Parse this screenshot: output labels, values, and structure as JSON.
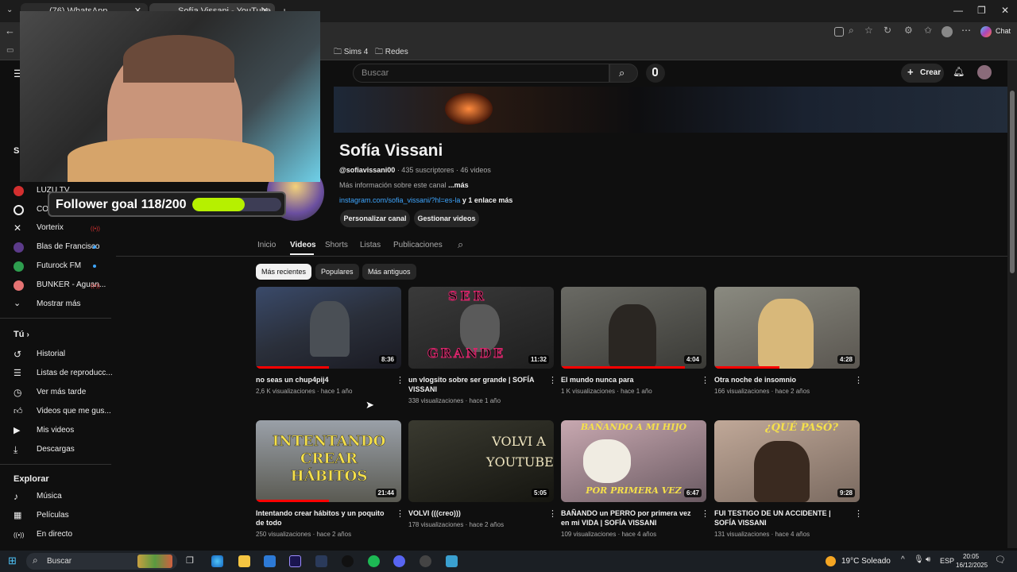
{
  "browser": {
    "tabs": [
      {
        "label": "(76) WhatsApp"
      },
      {
        "label": "Sofía Vissani - YouTube"
      }
    ],
    "bookmarks": [
      "Sims 4",
      "Redes"
    ],
    "chat_label": "Chat"
  },
  "youtube": {
    "search_placeholder": "Buscar",
    "create_label": "Crear",
    "sidebar": {
      "subscriptions": [
        {
          "label": "LUZU TV"
        },
        {
          "label": "COM"
        },
        {
          "label": "Vorterix"
        },
        {
          "label": "Blas de Francisco"
        },
        {
          "label": "Futurock FM"
        },
        {
          "label": "BUNKER - Aguan..."
        }
      ],
      "show_more": "Mostrar más",
      "you_header": "Tú",
      "you_items": [
        {
          "label": "Historial"
        },
        {
          "label": "Listas de reproducc..."
        },
        {
          "label": "Ver más tarde"
        },
        {
          "label": "Videos que me gus..."
        },
        {
          "label": "Mis videos"
        },
        {
          "label": "Descargas"
        }
      ],
      "explore_header": "Explorar",
      "explore_items": [
        {
          "label": "Música"
        },
        {
          "label": "Películas"
        },
        {
          "label": "En directo"
        }
      ]
    },
    "channel": {
      "name": "Sofía Vissani",
      "handle": "@sofiavissani00",
      "stats": " · 435 suscriptores · 46 videos",
      "about": "Más información sobre este canal",
      "about_more": "...más",
      "link": "instagram.com/sofia_vissani/?hl=es-la",
      "link_more": " y 1 enlace más",
      "customize_btn": "Personalizar canal",
      "manage_btn": "Gestionar videos",
      "tabs": [
        "Inicio",
        "Videos",
        "Shorts",
        "Listas",
        "Publicaciones"
      ],
      "active_tab": "Videos",
      "chips": [
        "Más recientes",
        "Populares",
        "Más antiguos"
      ]
    },
    "videos": [
      {
        "title": "no seas un chup4pij4",
        "meta": "2,6 K visualizaciones · hace 1 año",
        "duration": "8:36",
        "progress": 0.5
      },
      {
        "title": "un vlogsito sobre ser grande | SOFÍA VISSANI",
        "meta": "338 visualizaciones · hace 1 año",
        "duration": "11:32",
        "thumb_text_top": "SER",
        "thumb_text_bottom": "GRANDE",
        "progress": 0
      },
      {
        "title": "El mundo nunca para",
        "meta": "1 K visualizaciones · hace 1 año",
        "duration": "4:04",
        "progress": 0.85
      },
      {
        "title": "Otra noche de insomnio",
        "meta": "166 visualizaciones · hace 2 años",
        "duration": "4:28",
        "progress": 0.45
      },
      {
        "title": "Intentando crear hábitos y un poquito de todo",
        "meta": "250 visualizaciones · hace 2 años",
        "duration": "21:44",
        "thumb_text": "INTENTANDO CREAR HÁBITOS",
        "progress": 0.5
      },
      {
        "title": "VOLVI (((creo)))",
        "meta": "178 visualizaciones · hace 2 años",
        "duration": "5:05",
        "thumb_text": "VOLVI A YOUTUBE",
        "progress": 0
      },
      {
        "title": "BAÑANDO un PERRO por primera vez en mi VIDA | SOFÍA VISSANI",
        "meta": "109 visualizaciones · hace 4 años",
        "duration": "6:47",
        "thumb_text_top": "BAÑANDO A MI HIJO",
        "thumb_text_bottom": "POR PRIMERA VEZ",
        "progress": 0
      },
      {
        "title": "FUI TESTIGO DE UN ACCIDENTE | SOFÍA VISSANI",
        "meta": "131 visualizaciones · hace 4 años",
        "duration": "9:28",
        "thumb_text": "¿QUÉ PASÓ?",
        "progress": 0
      }
    ]
  },
  "overlay": {
    "goal_text": "Follower goal 118/200",
    "goal_progress": 0.59
  },
  "taskbar": {
    "search": "Buscar",
    "weather": "19°C  Soleado",
    "lang": "ESP",
    "time": "20:05",
    "date": "16/12/2025"
  },
  "colors": {
    "accent_red": "#ff0000",
    "link_blue": "#3ea6ff",
    "goal_green": "#b6f000"
  }
}
